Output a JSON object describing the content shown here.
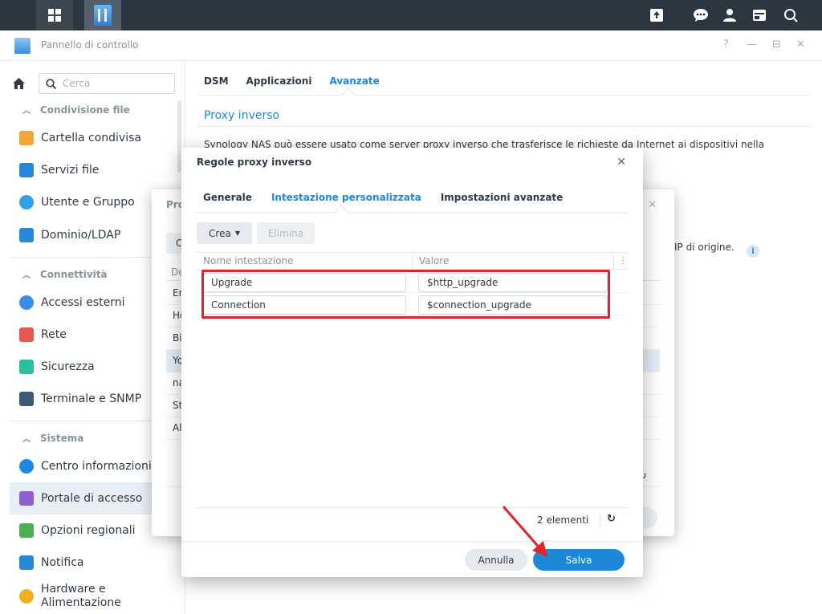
{
  "taskbar": {
    "left_icons": [
      "apps-grid-icon",
      "control-panel-app-icon"
    ],
    "right_icons": [
      "upload-icon",
      "chat-icon",
      "user-icon",
      "widgets-icon",
      "search-icon"
    ]
  },
  "window": {
    "title": "Pannello di controllo",
    "controls": [
      "?",
      "—",
      "⊟",
      "✕"
    ]
  },
  "sidebar": {
    "search_placeholder": "Cerca",
    "sections": {
      "condivisione": "Condivisione file",
      "connettivita": "Connettività",
      "sistema": "Sistema"
    },
    "items": [
      {
        "label": "Cartella condivisa",
        "icon": "folder-icon",
        "color": "#f4a53a"
      },
      {
        "label": "Servizi file",
        "icon": "file-services-icon",
        "color": "#2a86d6"
      },
      {
        "label": "Utente e Gruppo",
        "icon": "users-icon",
        "color": "#33a0e8"
      },
      {
        "label": "Dominio/LDAP",
        "icon": "domain-icon",
        "color": "#2a86d6"
      },
      {
        "label": "Accessi esterni",
        "icon": "external-access-icon",
        "color": "#3a8ee6"
      },
      {
        "label": "Rete",
        "icon": "network-icon",
        "color": "#e35a4c"
      },
      {
        "label": "Sicurezza",
        "icon": "shield-icon",
        "color": "#2bbfa2"
      },
      {
        "label": "Terminale e SNMP",
        "icon": "terminal-icon",
        "color": "#3b5a78"
      },
      {
        "label": "Centro informazioni",
        "icon": "info-center-icon",
        "color": "#1f88e5"
      },
      {
        "label": "Portale di accesso",
        "icon": "login-portal-icon",
        "color": "#8e5fd1"
      },
      {
        "label": "Opzioni regionali",
        "icon": "regional-options-icon",
        "color": "#4bb04f"
      },
      {
        "label": "Notifica",
        "icon": "notification-icon",
        "color": "#2a86d6"
      },
      {
        "label": "Hardware e Alimentazione",
        "icon": "hardware-power-icon",
        "color": "#f2b01e"
      }
    ]
  },
  "main": {
    "tabs": [
      "DSM",
      "Applicazioni",
      "Avanzate"
    ],
    "active_tab": "Avanzate",
    "section_title": "Proxy inverso",
    "description": "Synology NAS può essere usato come server proxy inverso che trasferisce le richieste da Internet ai dispositivi nella",
    "ip_text": "IP di origine."
  },
  "bg_dialog": {
    "title": "Pro",
    "button": "C",
    "header": "De",
    "rows": [
      "Er",
      "Ho",
      "Bi",
      "Yo",
      "na",
      "St",
      "Al"
    ]
  },
  "dialog": {
    "title": "Regole proxy inverso",
    "tabs": [
      "Generale",
      "Intestazione personalizzata",
      "Impostazioni avanzate"
    ],
    "active_tab": "Intestazione personalizzata",
    "toolbar": {
      "create": "Crea",
      "delete": "Elimina"
    },
    "columns": [
      "Nome intestazione",
      "Valore"
    ],
    "rows": [
      {
        "name": "Upgrade",
        "value": "$http_upgrade"
      },
      {
        "name": "Connection",
        "value": "$connection_upgrade"
      }
    ],
    "count": "2 elementi",
    "buttons": {
      "cancel": "Annulla",
      "save": "Salva"
    }
  },
  "colors": {
    "accent": "#1e88d8",
    "annotation": "#e0242b"
  }
}
